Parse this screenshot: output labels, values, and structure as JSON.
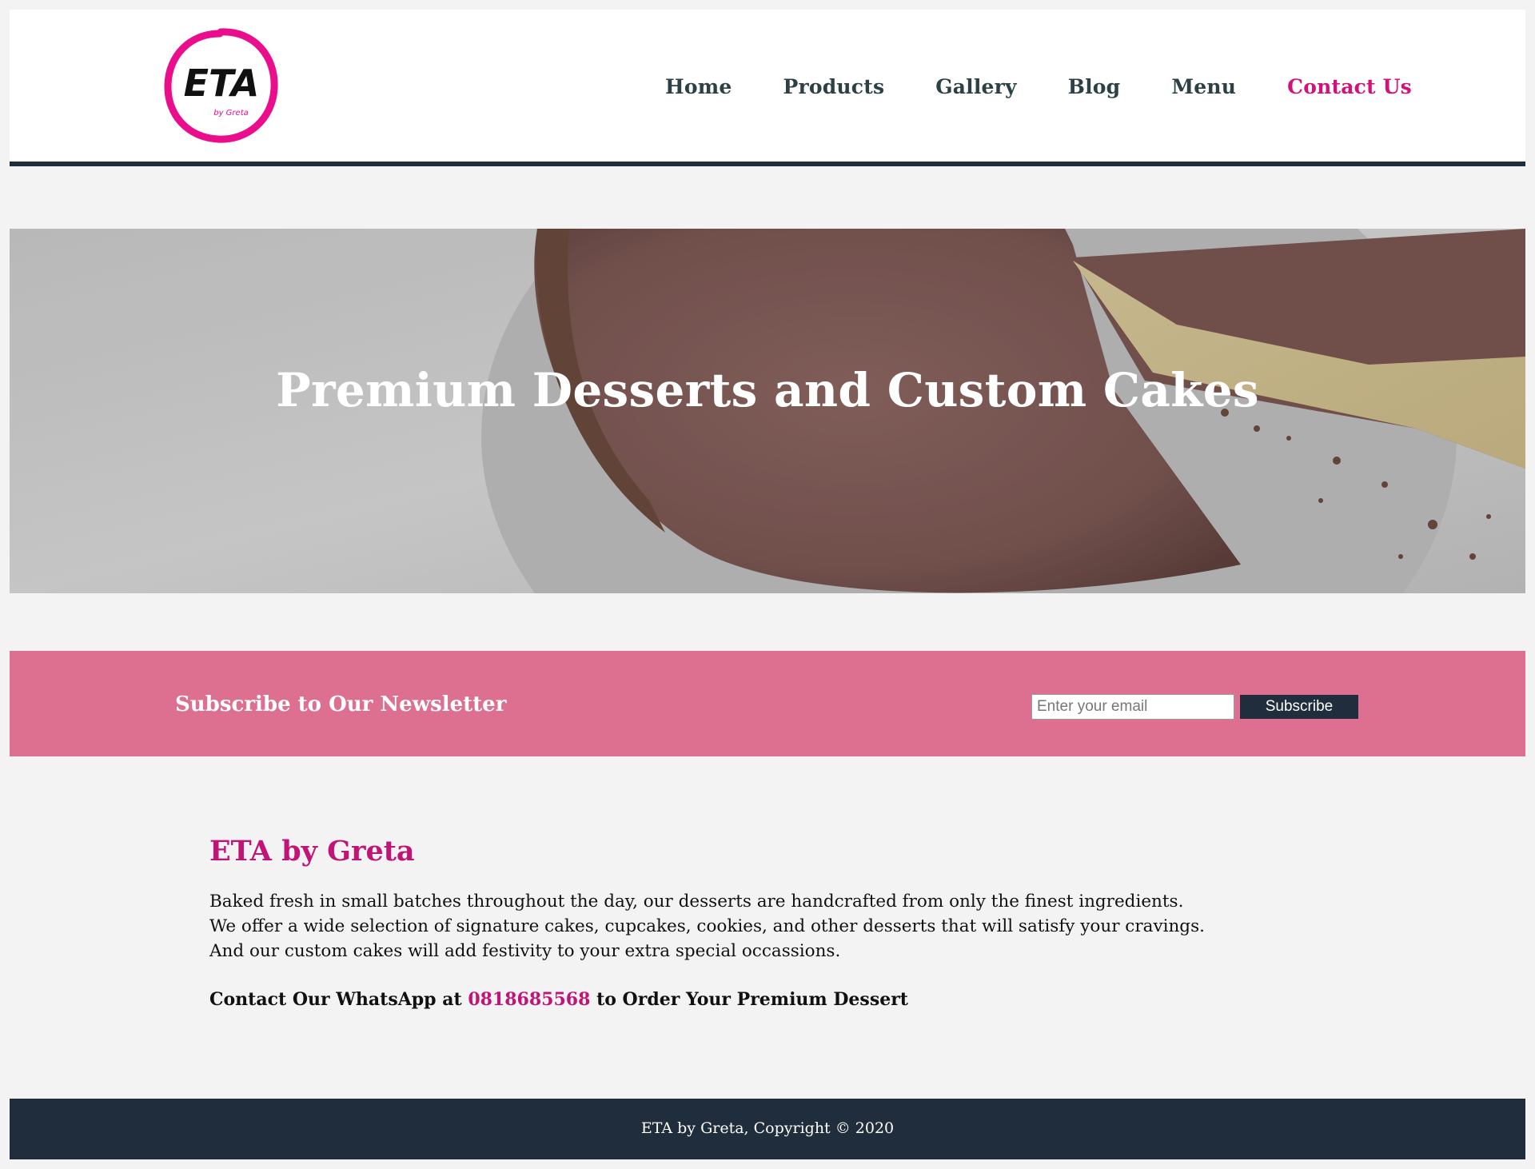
{
  "header": {
    "logo_text": "ETA",
    "logo_subtext": "by Greta",
    "nav": [
      {
        "label": "Home"
      },
      {
        "label": "Products"
      },
      {
        "label": "Gallery"
      },
      {
        "label": "Blog"
      },
      {
        "label": "Menu"
      },
      {
        "label": "Contact Us",
        "active": true
      }
    ]
  },
  "hero": {
    "title": "Premium Desserts and Custom Cakes"
  },
  "newsletter": {
    "title": "Subscribe to Our Newsletter",
    "email_placeholder": "Enter your email",
    "email_value": "",
    "button_label": "Subscribe"
  },
  "about": {
    "title": "ETA by Greta",
    "lines": [
      "Baked fresh in small batches throughout the day, our desserts are handcrafted from only the finest ingredients.",
      "We offer a wide selection of signature cakes, cupcakes, cookies, and other desserts that will satisfy your cravings.",
      "And our custom cakes will add festivity to your extra special occassions."
    ],
    "contact_prefix": "Contact Our WhatsApp at",
    "phone": "0818685568",
    "contact_suffix": "to Order Your Premium Dessert"
  },
  "footer": {
    "text": "ETA by Greta, Copyright © 2020"
  },
  "colors": {
    "accent_pink": "#d1127a",
    "navy": "#202d3c",
    "newsletter_bg": "#dd6f90",
    "page_bg": "#f3f3f3"
  }
}
